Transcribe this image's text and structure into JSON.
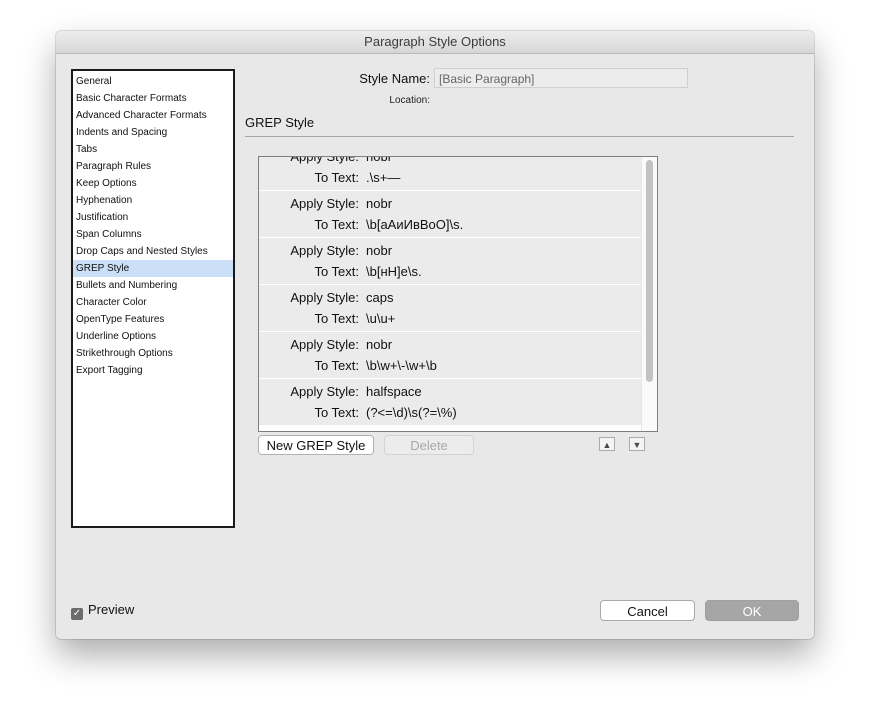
{
  "window": {
    "title": "Paragraph Style Options"
  },
  "categories": [
    {
      "label": "General"
    },
    {
      "label": "Basic Character Formats"
    },
    {
      "label": "Advanced Character Formats"
    },
    {
      "label": "Indents and Spacing"
    },
    {
      "label": "Tabs"
    },
    {
      "label": "Paragraph Rules"
    },
    {
      "label": "Keep Options"
    },
    {
      "label": "Hyphenation"
    },
    {
      "label": "Justification"
    },
    {
      "label": "Span Columns"
    },
    {
      "label": "Drop Caps and Nested Styles"
    },
    {
      "label": "GREP Style",
      "selected": true
    },
    {
      "label": "Bullets and Numbering"
    },
    {
      "label": "Character Color"
    },
    {
      "label": "OpenType Features"
    },
    {
      "label": "Underline Options"
    },
    {
      "label": "Strikethrough Options"
    },
    {
      "label": "Export Tagging"
    }
  ],
  "style_name": {
    "label": "Style Name:",
    "value": "[Basic Paragraph]"
  },
  "location": {
    "label": "Location:"
  },
  "section": {
    "title": "GREP Style"
  },
  "grep_styles": {
    "apply_label": "Apply Style:",
    "text_label": "To Text:",
    "items": [
      {
        "style": "nobr",
        "to_text": ".\\s+—"
      },
      {
        "style": "nobr",
        "to_text": "\\b[аАиИвВоО]\\s."
      },
      {
        "style": "nobr",
        "to_text": "\\b[нН]е\\s."
      },
      {
        "style": "caps",
        "to_text": "\\u\\u+"
      },
      {
        "style": "nobr",
        "to_text": "\\b\\w+\\-\\w+\\b"
      },
      {
        "style": "halfspace",
        "to_text": "(?<=\\d)\\s(?=\\%)"
      }
    ]
  },
  "buttons": {
    "new_grep": "New GREP Style",
    "delete": "Delete",
    "move_up": "▲",
    "move_down": "▼",
    "cancel": "Cancel",
    "ok": "OK"
  },
  "preview": {
    "label": "Preview",
    "checked": true
  }
}
